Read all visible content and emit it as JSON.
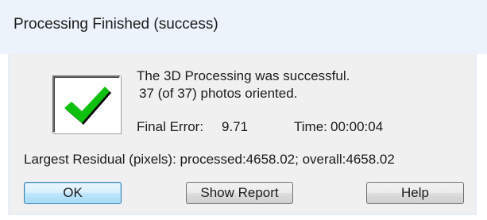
{
  "window": {
    "title": "Processing Finished (success)"
  },
  "message": {
    "line1": "The 3D Processing was successful.",
    "line2": "37 (of 37) photos oriented."
  },
  "stats": {
    "final_error_label": "Final Error:",
    "final_error_value": "9.71",
    "time_label": "Time:",
    "time_value": "00:00:04",
    "residual": "Largest Residual (pixels): processed:4658.02; overall:4658.02"
  },
  "icons": {
    "status": "checkmark-icon"
  },
  "colors": {
    "check_green": "#10c010",
    "title_bar": "#edf3fa",
    "dialog_bg": "#f0f0f0"
  },
  "buttons": {
    "ok_label": "OK",
    "show_report_label": "Show Report",
    "help_label": "Help"
  }
}
